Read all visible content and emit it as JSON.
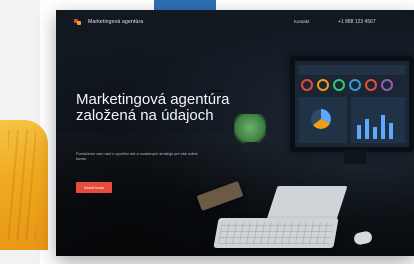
{
  "brand": {
    "name": "Marketingová agentúra"
  },
  "nav": {
    "link_label": "Kontakt",
    "phone": "+1 888 123 4567"
  },
  "hero": {
    "headline": "Marketingová agentúra založená na údajoch",
    "subtext": "Pomôžeme vám rásť s využitím dát a moderných stratégií pre váš online biznis.",
    "cta_label": "Začať teraz"
  },
  "colors": {
    "accent": "#e74c3c",
    "background_dark": "#121820"
  }
}
